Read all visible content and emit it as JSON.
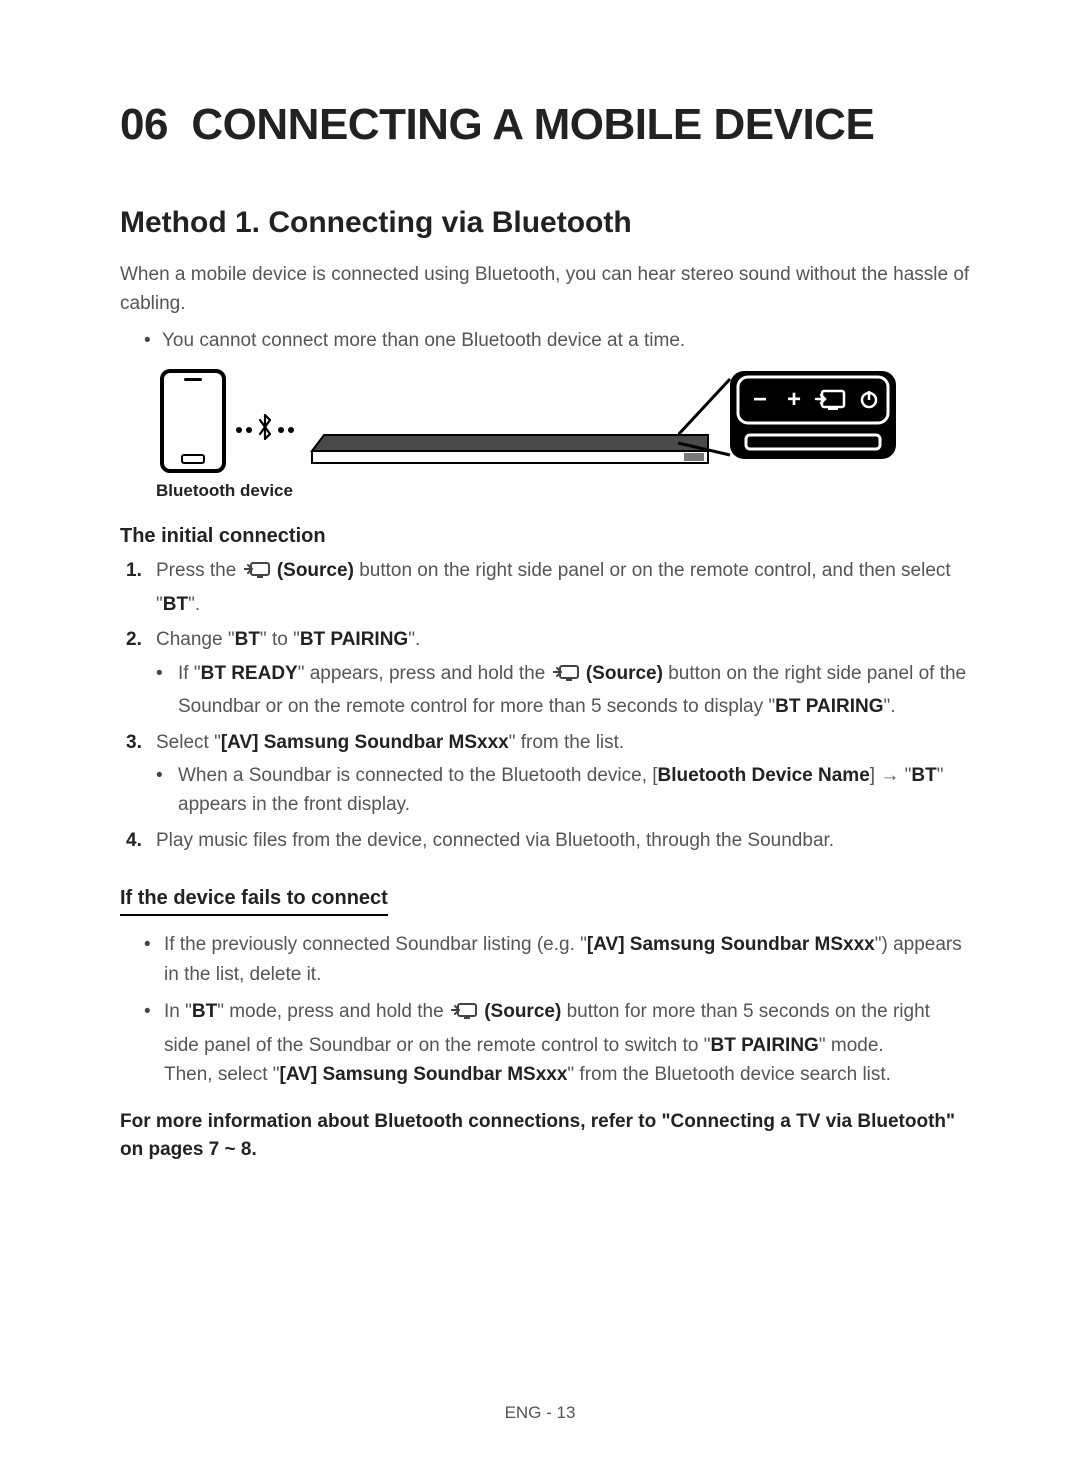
{
  "section_number": "06",
  "section_title": "CONNECTING A MOBILE DEVICE",
  "method_title": "Method 1. Connecting via Bluetooth",
  "intro": "When a mobile device is connected using Bluetooth, you can hear stereo sound without the hassle of cabling.",
  "top_bullet": "You cannot connect more than one Bluetooth device at a time.",
  "diagram": {
    "caption": "Bluetooth device",
    "panel_symbols": "−  +  ⮌  ⏻"
  },
  "initial": {
    "heading": "The initial connection",
    "s1_a": "Press the ",
    "s1_src": "(Source)",
    "s1_b": " button on the right side panel or on the remote control, and then select \"",
    "s1_bt": "BT",
    "s1_c": "\".",
    "s2_a": "Change \"",
    "s2_bt": "BT",
    "s2_b": "\" to \"",
    "s2_pair": "BT PAIRING",
    "s2_c": "\".",
    "s2_bul_a": "If \"",
    "s2_bul_ready": "BT READY",
    "s2_bul_b": "\" appears, press and hold the ",
    "s2_bul_src": "(Source)",
    "s2_bul_c": " button on the right side panel of the Soundbar or on the remote control for more than 5 seconds to display \"",
    "s2_bul_pair": "BT PAIRING",
    "s2_bul_d": "\".",
    "s3_a": "Select \"",
    "s3_name": "[AV] Samsung Soundbar MSxxx",
    "s3_b": "\" from the list.",
    "s3_bul_a": "When a Soundbar is connected to the Bluetooth device, [",
    "s3_bul_name": "Bluetooth Device Name",
    "s3_bul_b": "] → \"",
    "s3_bul_bt": "BT",
    "s3_bul_c": "\" appears in the front display.",
    "s4": "Play music files from the device, connected via Bluetooth, through the Soundbar."
  },
  "fails": {
    "heading": "If the device fails to connect",
    "b1_a": "If the previously connected Soundbar listing (e.g. \"",
    "b1_name": "[AV] Samsung Soundbar MSxxx",
    "b1_b": "\") appears in the list, delete it.",
    "b2_a": "In \"",
    "b2_bt": "BT",
    "b2_b": "\" mode, press and hold the ",
    "b2_src": "(Source)",
    "b2_c": " button for more than 5 seconds on the right side panel of the Soundbar or on the remote control to switch to \"",
    "b2_pair": "BT PAIRING",
    "b2_d": "\" mode.",
    "b2_e": "Then, select \"",
    "b2_name": "[AV] Samsung Soundbar MSxxx",
    "b2_f": "\" from the Bluetooth device search list."
  },
  "more_info": "For more information about Bluetooth connections, refer to \"Connecting a TV via Bluetooth\" on pages 7 ~ 8.",
  "footer": "ENG - 13"
}
